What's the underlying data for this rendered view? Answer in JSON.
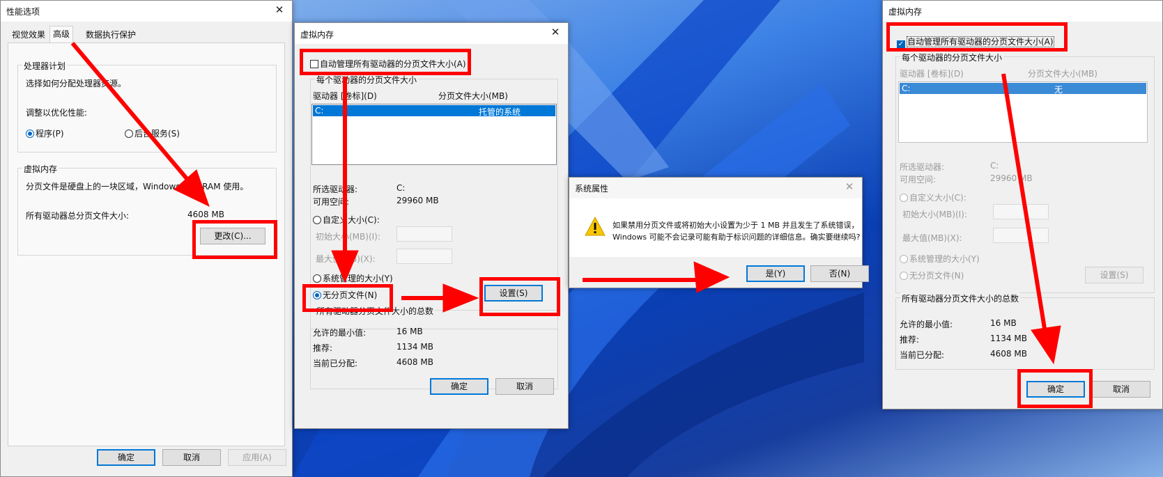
{
  "perf": {
    "title": "性能选项",
    "tabs": [
      "视觉效果",
      "高级",
      "数据执行保护"
    ],
    "cpu_group": "处理器计划",
    "cpu_desc": "选择如何分配处理器资源。",
    "cpu_adjust": "调整以优化性能:",
    "opt_programs": "程序(P)",
    "opt_services": "后台服务(S)",
    "vm_group": "虚拟内存",
    "vm_desc": "分页文件是硬盘上的一块区域，Windows 当作 RAM 使用。",
    "vm_total_label": "所有驱动器总分页文件大小:",
    "vm_total_value": "4608 MB",
    "change_button": "更改(C)...",
    "ok": "确定",
    "cancel": "取消",
    "apply": "应用(A)"
  },
  "vm1": {
    "title": "虚拟内存",
    "auto_manage": "自动管理所有驱动器的分页文件大小(A)",
    "per_drive_group": "每个驱动器的分页文件大小",
    "col_drive": "驱动器 [卷标](D)",
    "col_size": "分页文件大小(MB)",
    "drive_row": {
      "drive": "C:",
      "size": "托管的系统"
    },
    "selected_drive_label": "所选驱动器:",
    "selected_drive_value": "C:",
    "free_space_label": "可用空间:",
    "free_space_value": "29960 MB",
    "custom_size": "自定义大小(C):",
    "initial_size": "初始大小(MB)(I):",
    "max_size": "最大值(MB)(X):",
    "system_managed": "系统管理的大小(Y)",
    "no_paging": "无分页文件(N)",
    "set_button": "设置(S)",
    "total_group": "所有驱动器分页文件大小的总数",
    "min_label": "允许的最小值:",
    "min_value": "16 MB",
    "rec_label": "推荐:",
    "rec_value": "1134 MB",
    "cur_label": "当前已分配:",
    "cur_value": "4608 MB",
    "ok": "确定",
    "cancel": "取消"
  },
  "sys": {
    "title": "系统属性",
    "message_line1": "如果禁用分页文件或将初始大小设置为少于 1 MB 并且发生了系统错误，",
    "message_line2": "Windows 可能不会记录可能有助于标识问题的详细信息。确实要继续吗?",
    "yes": "是(Y)",
    "no": "否(N)"
  },
  "vm2": {
    "title": "虚拟内存",
    "auto_manage": "自动管理所有驱动器的分页文件大小(A)",
    "per_drive_group": "每个驱动器的分页文件大小",
    "col_drive": "驱动器 [卷标](D)",
    "col_size": "分页文件大小(MB)",
    "drive_row": {
      "drive": "C:",
      "size": "无"
    },
    "selected_drive_label": "所选驱动器:",
    "selected_drive_value": "C:",
    "free_space_label": "可用空间:",
    "free_space_value": "29960 MB",
    "custom_size": "自定义大小(C):",
    "initial_size": "初始大小(MB)(I):",
    "max_size": "最大值(MB)(X):",
    "system_managed": "系统管理的大小(Y)",
    "no_paging": "无分页文件(N)",
    "set_button": "设置(S)",
    "total_group": "所有驱动器分页文件大小的总数",
    "min_label": "允许的最小值:",
    "min_value": "16 MB",
    "rec_label": "推荐:",
    "rec_value": "1134 MB",
    "cur_label": "当前已分配:",
    "cur_value": "4608 MB",
    "ok": "确定",
    "cancel": "取消"
  },
  "colors": {
    "annotation": "#ff0000",
    "accent": "#0078d7",
    "warning": "#f7c600"
  },
  "icons": {
    "warning": "warning-triangle-icon",
    "close": "close-icon",
    "checkbox": "checkmark-icon"
  }
}
